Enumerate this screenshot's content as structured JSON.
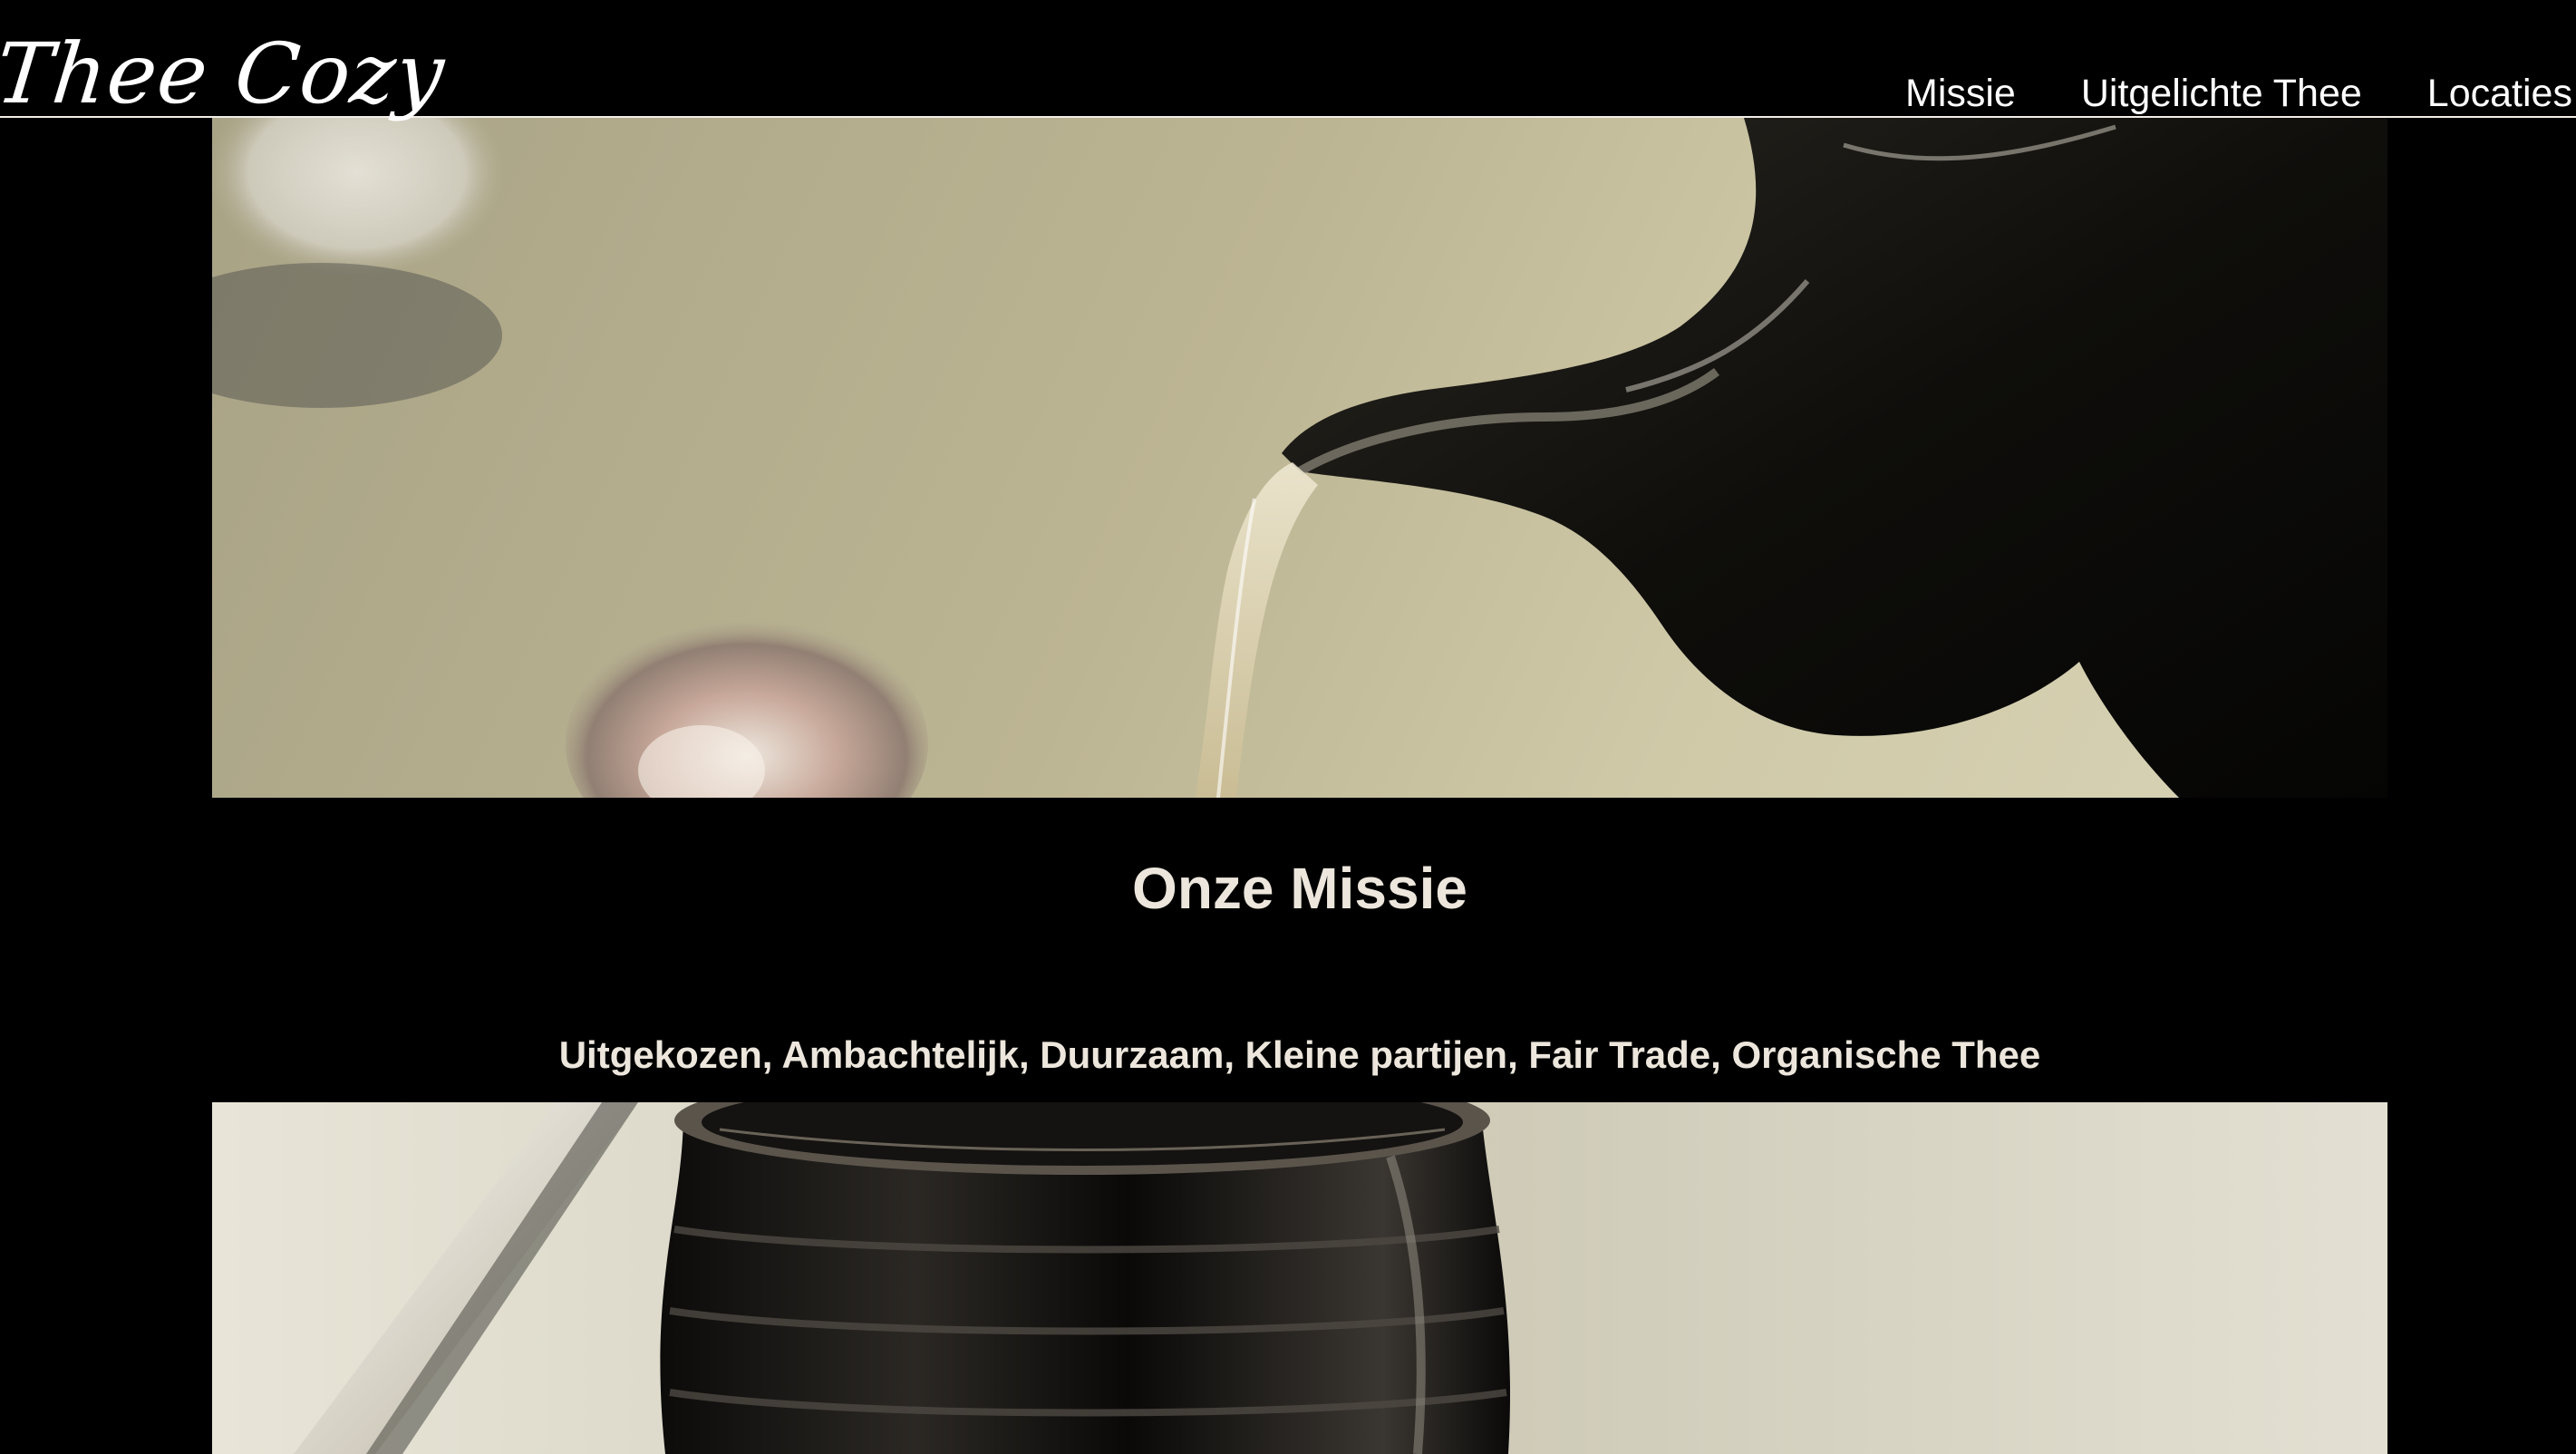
{
  "header": {
    "logo": "Thee Cozy",
    "nav": [
      {
        "label": "Missie"
      },
      {
        "label": "Uitgelichte Thee"
      },
      {
        "label": "Locaties"
      }
    ]
  },
  "hero": {
    "image": "teapot-pouring-image"
  },
  "mission": {
    "title": "Onze Missie",
    "tagline": "Uitgekozen, Ambachtelijk, Duurzaam, Kleine partijen, Fair Trade, Organische Thee"
  },
  "second_section": {
    "image": "tea-cup-image"
  },
  "colors": {
    "background": "#000000",
    "text": "#ffffff",
    "mission_text": "#ece6dc",
    "divider": "#f2ede6"
  }
}
